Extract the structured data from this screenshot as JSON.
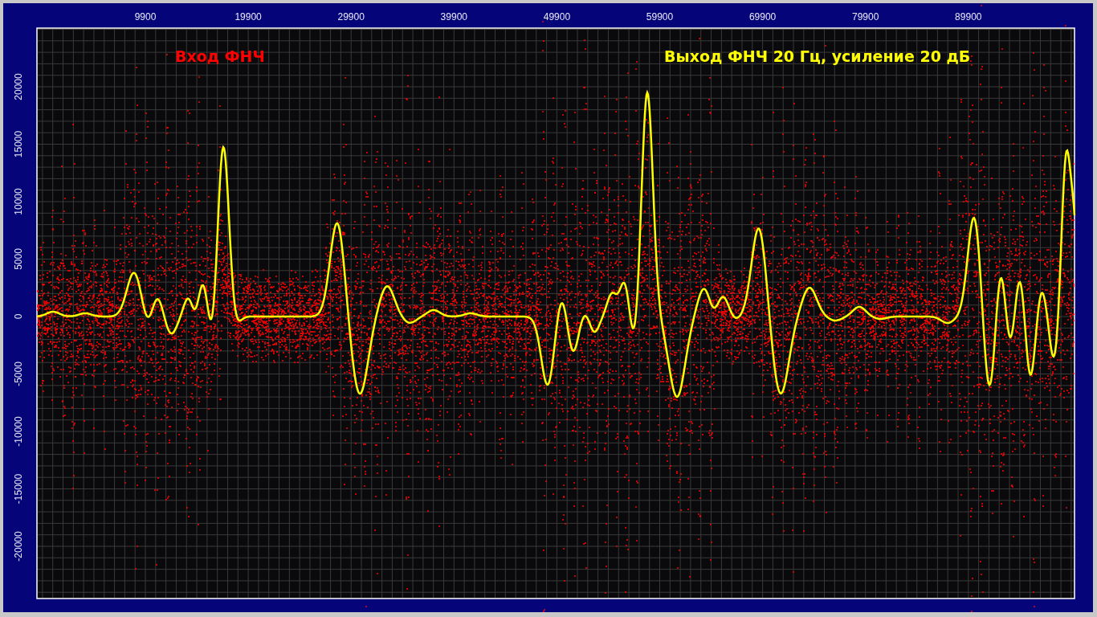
{
  "chart": {
    "series": [
      {
        "label": "Вход ФНЧ",
        "color": "#ff0000"
      },
      {
        "label": "Выход ФНЧ 20 Гц, усиление 20 дБ",
        "color": "#ffff00"
      }
    ],
    "x_ticks": [
      "9900",
      "19900",
      "29900",
      "39900",
      "49900",
      "59900",
      "69900",
      "79900",
      "89900"
    ],
    "y_ticks": [
      "20000",
      "15000",
      "10000",
      "5000",
      "0",
      "-5000",
      "-10000",
      "-15000",
      "-20000"
    ]
  }
}
